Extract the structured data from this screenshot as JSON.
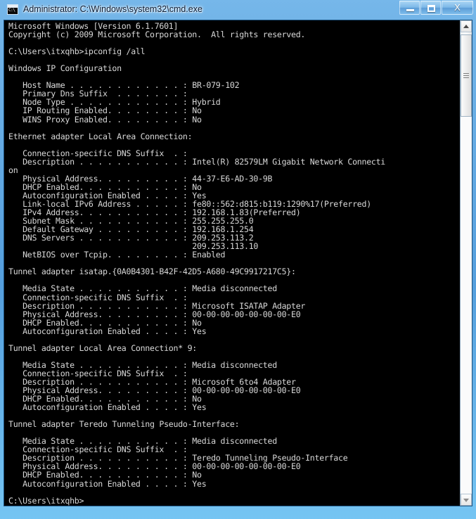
{
  "window": {
    "title": "Administrator: C:\\Windows\\system32\\cmd.exe",
    "icon": "cmd-console-icon",
    "icon_text": "C:\\",
    "controls": {
      "minimize_label": "Minimize",
      "maximize_label": "Maximize",
      "close_label": "X"
    }
  },
  "scrollbar": {
    "up_arrow": "scroll-up-arrow-icon",
    "down_arrow": "scroll-down-arrow-icon",
    "thumb": "scrollbar-thumb"
  },
  "console": {
    "background_color": "#000000",
    "text_color": "#d8d8d8",
    "prompt": "C:\\Users\\itxqhb>",
    "command": "ipconfig /all",
    "content": "Microsoft Windows [Version 6.1.7601]\nCopyright (c) 2009 Microsoft Corporation.  All rights reserved.\n\nC:\\Users\\itxqhb>ipconfig /all\n\nWindows IP Configuration\n\n   Host Name . . . . . . . . . . . . : BR-079-102\n   Primary Dns Suffix  . . . . . . . :\n   Node Type . . . . . . . . . . . . : Hybrid\n   IP Routing Enabled. . . . . . . . : No\n   WINS Proxy Enabled. . . . . . . . : No\n\nEthernet adapter Local Area Connection:\n\n   Connection-specific DNS Suffix  . :\n   Description . . . . . . . . . . . : Intel(R) 82579LM Gigabit Network Connecti\non\n   Physical Address. . . . . . . . . : 44-37-E6-AD-30-9B\n   DHCP Enabled. . . . . . . . . . . : No\n   Autoconfiguration Enabled . . . . : Yes\n   Link-local IPv6 Address . . . . . : fe80::562:d815:b119:1290%17(Preferred)\n   IPv4 Address. . . . . . . . . . . : 192.168.1.83(Preferred)\n   Subnet Mask . . . . . . . . . . . : 255.255.255.0\n   Default Gateway . . . . . . . . . : 192.168.1.254\n   DNS Servers . . . . . . . . . . . : 209.253.113.2\n                                       209.253.113.10\n   NetBIOS over Tcpip. . . . . . . . : Enabled\n\nTunnel adapter isatap.{0A0B4301-B42F-42D5-A680-49C9917217C5}:\n\n   Media State . . . . . . . . . . . : Media disconnected\n   Connection-specific DNS Suffix  . :\n   Description . . . . . . . . . . . : Microsoft ISATAP Adapter\n   Physical Address. . . . . . . . . : 00-00-00-00-00-00-00-E0\n   DHCP Enabled. . . . . . . . . . . : No\n   Autoconfiguration Enabled . . . . : Yes\n\nTunnel adapter Local Area Connection* 9:\n\n   Media State . . . . . . . . . . . : Media disconnected\n   Connection-specific DNS Suffix  . :\n   Description . . . . . . . . . . . : Microsoft 6to4 Adapter\n   Physical Address. . . . . . . . . : 00-00-00-00-00-00-00-E0\n   DHCP Enabled. . . . . . . . . . . : No\n   Autoconfiguration Enabled . . . . : Yes\n\nTunnel adapter Teredo Tunneling Pseudo-Interface:\n\n   Media State . . . . . . . . . . . : Media disconnected\n   Connection-specific DNS Suffix  . :\n   Description . . . . . . . . . . . : Teredo Tunneling Pseudo-Interface\n   Physical Address. . . . . . . . . : 00-00-00-00-00-00-00-E0\n   DHCP Enabled. . . . . . . . . . . : No\n   Autoconfiguration Enabled . . . . : Yes\n\nC:\\Users\\itxqhb>",
    "sections": {
      "banner": [
        "Microsoft Windows [Version 6.1.7601]",
        "Copyright (c) 2009 Microsoft Corporation.  All rights reserved."
      ],
      "ip_configuration": {
        "heading": "Windows IP Configuration",
        "entries": [
          {
            "label": "Host Name",
            "value": "BR-079-102"
          },
          {
            "label": "Primary Dns Suffix",
            "value": ""
          },
          {
            "label": "Node Type",
            "value": "Hybrid"
          },
          {
            "label": "IP Routing Enabled",
            "value": "No"
          },
          {
            "label": "WINS Proxy Enabled",
            "value": "No"
          }
        ]
      },
      "adapters": [
        {
          "heading": "Ethernet adapter Local Area Connection:",
          "entries": [
            {
              "label": "Connection-specific DNS Suffix",
              "value": ""
            },
            {
              "label": "Description",
              "value": "Intel(R) 82579LM Gigabit Network Connection"
            },
            {
              "label": "Physical Address",
              "value": "44-37-E6-AD-30-9B"
            },
            {
              "label": "DHCP Enabled",
              "value": "No"
            },
            {
              "label": "Autoconfiguration Enabled",
              "value": "Yes"
            },
            {
              "label": "Link-local IPv6 Address",
              "value": "fe80::562:d815:b119:1290%17(Preferred)"
            },
            {
              "label": "IPv4 Address",
              "value": "192.168.1.83(Preferred)"
            },
            {
              "label": "Subnet Mask",
              "value": "255.255.255.0"
            },
            {
              "label": "Default Gateway",
              "value": "192.168.1.254"
            },
            {
              "label": "DNS Servers",
              "value": "209.253.113.2"
            },
            {
              "label": "",
              "value": "209.253.113.10"
            },
            {
              "label": "NetBIOS over Tcpip",
              "value": "Enabled"
            }
          ]
        },
        {
          "heading": "Tunnel adapter isatap.{0A0B4301-B42F-42D5-A680-49C9917217C5}:",
          "entries": [
            {
              "label": "Media State",
              "value": "Media disconnected"
            },
            {
              "label": "Connection-specific DNS Suffix",
              "value": ""
            },
            {
              "label": "Description",
              "value": "Microsoft ISATAP Adapter"
            },
            {
              "label": "Physical Address",
              "value": "00-00-00-00-00-00-00-E0"
            },
            {
              "label": "DHCP Enabled",
              "value": "No"
            },
            {
              "label": "Autoconfiguration Enabled",
              "value": "Yes"
            }
          ]
        },
        {
          "heading": "Tunnel adapter Local Area Connection* 9:",
          "entries": [
            {
              "label": "Media State",
              "value": "Media disconnected"
            },
            {
              "label": "Connection-specific DNS Suffix",
              "value": ""
            },
            {
              "label": "Description",
              "value": "Microsoft 6to4 Adapter"
            },
            {
              "label": "Physical Address",
              "value": "00-00-00-00-00-00-00-E0"
            },
            {
              "label": "DHCP Enabled",
              "value": "No"
            },
            {
              "label": "Autoconfiguration Enabled",
              "value": "Yes"
            }
          ]
        },
        {
          "heading": "Tunnel adapter Teredo Tunneling Pseudo-Interface:",
          "entries": [
            {
              "label": "Media State",
              "value": "Media disconnected"
            },
            {
              "label": "Connection-specific DNS Suffix",
              "value": ""
            },
            {
              "label": "Description",
              "value": "Teredo Tunneling Pseudo-Interface"
            },
            {
              "label": "Physical Address",
              "value": "00-00-00-00-00-00-00-E0"
            },
            {
              "label": "DHCP Enabled",
              "value": "No"
            },
            {
              "label": "Autoconfiguration Enabled",
              "value": "Yes"
            }
          ]
        }
      ]
    }
  }
}
